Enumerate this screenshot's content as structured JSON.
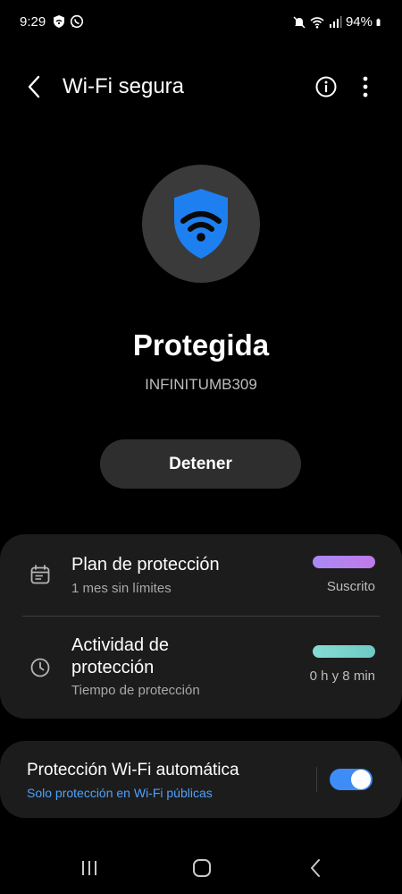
{
  "status_bar": {
    "time": "9:29",
    "battery": "94%",
    "left_icons": [
      "shield-icon",
      "whatsapp-icon"
    ],
    "right_icons": [
      "mute-icon",
      "wifi-icon",
      "signal-icon",
      "battery-icon"
    ]
  },
  "header": {
    "title": "Wi-Fi segura",
    "back_icon": "back-chevron-icon",
    "info_icon": "info-icon",
    "more_icon": "more-vertical-icon"
  },
  "hero": {
    "icon": "shield-wifi-icon",
    "status": "Protegida",
    "network": "INFINITUMB309",
    "stop_label": "Detener"
  },
  "plans": {
    "plan": {
      "icon": "calendar-icon",
      "title": "Plan de protección",
      "subtitle": "1 mes sin límites",
      "value": "Suscrito",
      "bar_color": "#b48af5"
    },
    "activity": {
      "icon": "clock-icon",
      "title_line1": "Actividad de",
      "title_line2": "protección",
      "subtitle": "Tiempo de protección",
      "value": "0 h y 8 min",
      "bar_color": "#7fd8d0"
    }
  },
  "auto_protection": {
    "title": "Protección Wi-Fi automática",
    "subtitle": "Solo protección en Wi-Fi públicas",
    "toggle_on": true
  },
  "navbar": {
    "recents_icon": "recents-icon",
    "home_icon": "home-icon",
    "back_icon": "nav-back-icon"
  },
  "colors": {
    "accent": "#3e8cf5",
    "shield": "#1e7ff0",
    "card_bg": "#1c1c1c"
  }
}
